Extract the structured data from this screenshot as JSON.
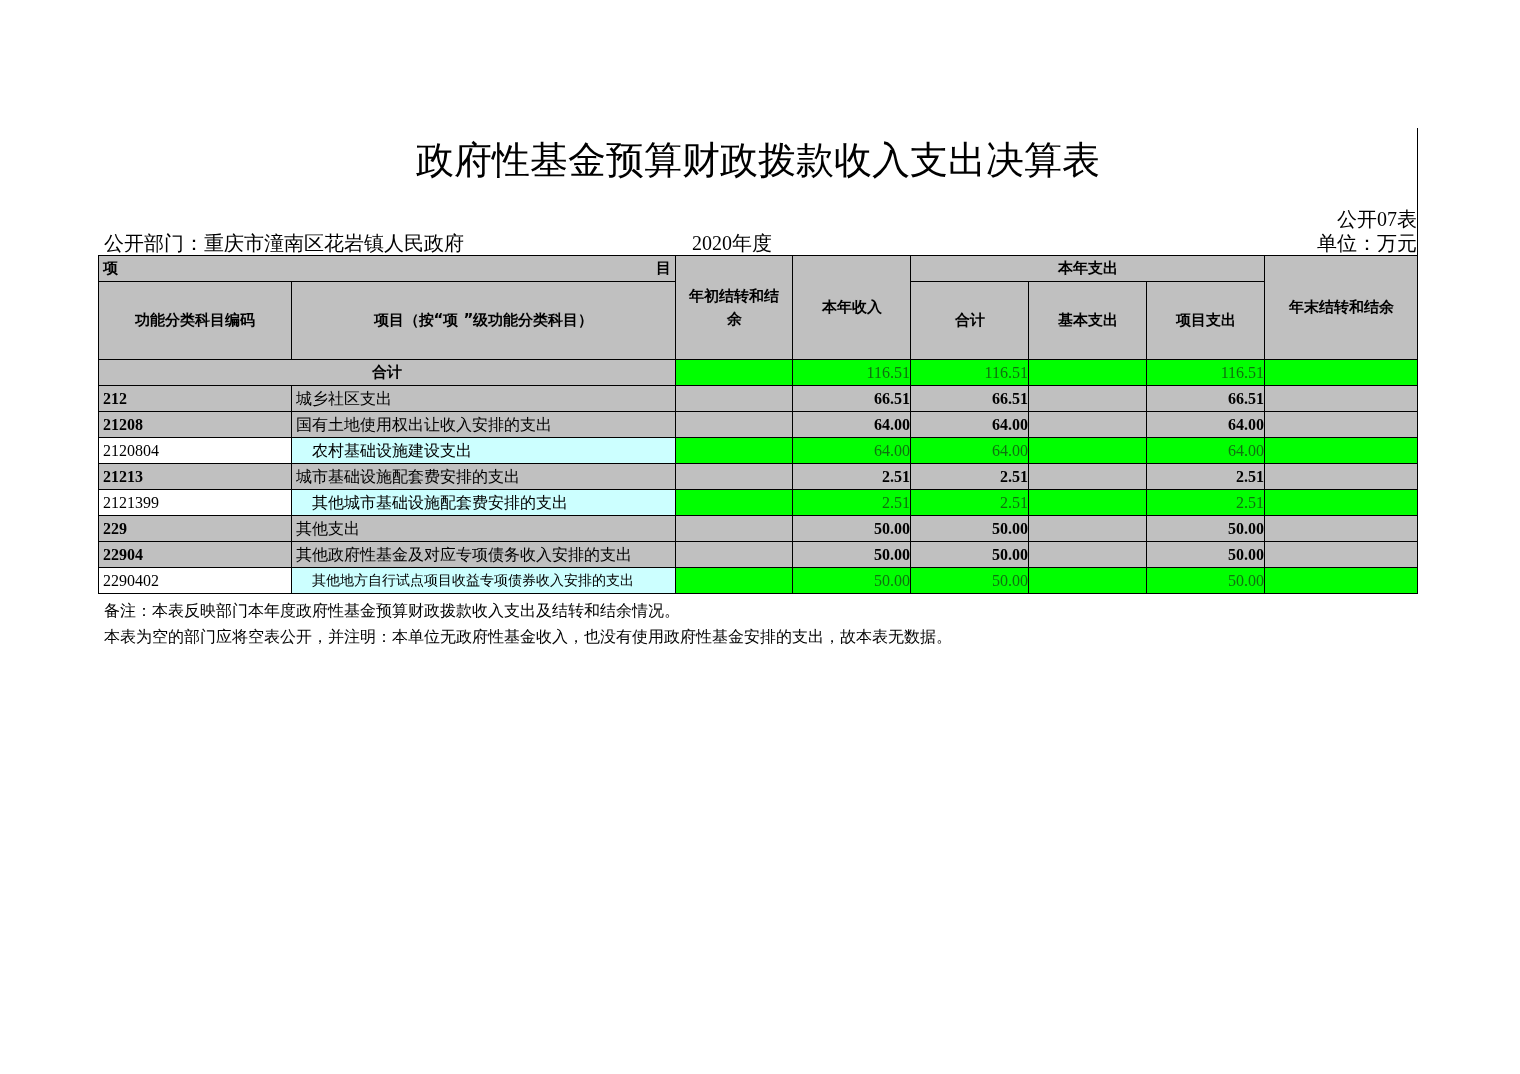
{
  "title": "政府性基金预算财政拨款收入支出决算表",
  "form_no": "公开07表",
  "department": "公开部门：重庆市潼南区花岩镇人民政府",
  "year": "2020年度",
  "unit": "单位：万元",
  "header": {
    "item_left": "项",
    "item_right": "目",
    "code": "功能分类科目编码",
    "name": "项目（按“项 ”级功能分类科目）",
    "opening": "年初结转和结余",
    "income": "本年收入",
    "expense": "本年支出",
    "total": "合计",
    "basic": "基本支出",
    "project": "项目支出",
    "closing": "年末结转和结余"
  },
  "total_row": {
    "label": "合计",
    "income": "116.51",
    "total": "116.51",
    "project": "116.51"
  },
  "rows": [
    {
      "kind": "category",
      "code": "212",
      "name": "城乡社区支出",
      "income": "66.51",
      "total": "66.51",
      "project": "66.51"
    },
    {
      "kind": "category",
      "code": "21208",
      "name": "国有土地使用权出让收入安排的支出",
      "income": "64.00",
      "total": "64.00",
      "project": "64.00"
    },
    {
      "kind": "item",
      "code": "2120804",
      "name": "农村基础设施建设支出",
      "income": "64.00",
      "total": "64.00",
      "project": "64.00"
    },
    {
      "kind": "category",
      "code": "21213",
      "name": "城市基础设施配套费安排的支出",
      "income": "2.51",
      "total": "2.51",
      "project": "2.51"
    },
    {
      "kind": "item",
      "code": "2121399",
      "name": "其他城市基础设施配套费安排的支出",
      "income": "2.51",
      "total": "2.51",
      "project": "2.51"
    },
    {
      "kind": "category",
      "code": "229",
      "name": "其他支出",
      "income": "50.00",
      "total": "50.00",
      "project": "50.00"
    },
    {
      "kind": "category",
      "code": "22904",
      "name": "其他政府性基金及对应专项债务收入安排的支出",
      "income": "50.00",
      "total": "50.00",
      "project": "50.00"
    },
    {
      "kind": "item",
      "code": "2290402",
      "name": "其他地方自行试点项目收益专项债券收入安排的支出",
      "small": true,
      "income": "50.00",
      "total": "50.00",
      "project": "50.00"
    }
  ],
  "notes": [
    "备注：本表反映部门本年度政府性基金预算财政拨款收入支出及结转和结余情况。",
    "本表为空的部门应将空表公开，并注明：本单位无政府性基金收入，也没有使用政府性基金安排的支出，故本表无数据。"
  ]
}
